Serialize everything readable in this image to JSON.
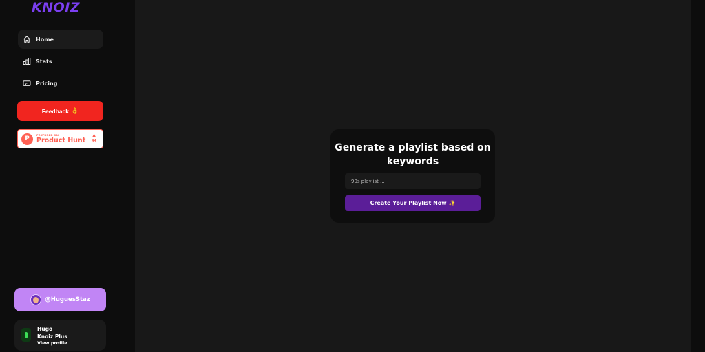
{
  "brand": {
    "logo_text": "KNOIZ",
    "accent": "#7b3ff0"
  },
  "sidebar": {
    "items": [
      {
        "label": "Home",
        "icon": "home-icon",
        "active": true
      },
      {
        "label": "Stats",
        "icon": "bar-chart-icon",
        "active": false
      },
      {
        "label": "Pricing",
        "icon": "ticket-icon",
        "active": false
      }
    ],
    "feedback": {
      "label": "Feedback",
      "emoji": "👌",
      "color": "#f1251f"
    },
    "product_hunt": {
      "featured": "FEATURED ON",
      "name": "Product Hunt",
      "votes": "44",
      "color": "#ff6154"
    },
    "user_handle": "@HuguesStaz",
    "profile": {
      "name": "Hugo",
      "plan": "Knoiz Plus",
      "link": "View profile"
    }
  },
  "main": {
    "title": "Generate a playlist based on keywords",
    "input_placeholder": "90s playlist ...",
    "input_value": "",
    "button_label": "Create Your Playlist Now ✨",
    "button_color": "#5b1e98"
  }
}
